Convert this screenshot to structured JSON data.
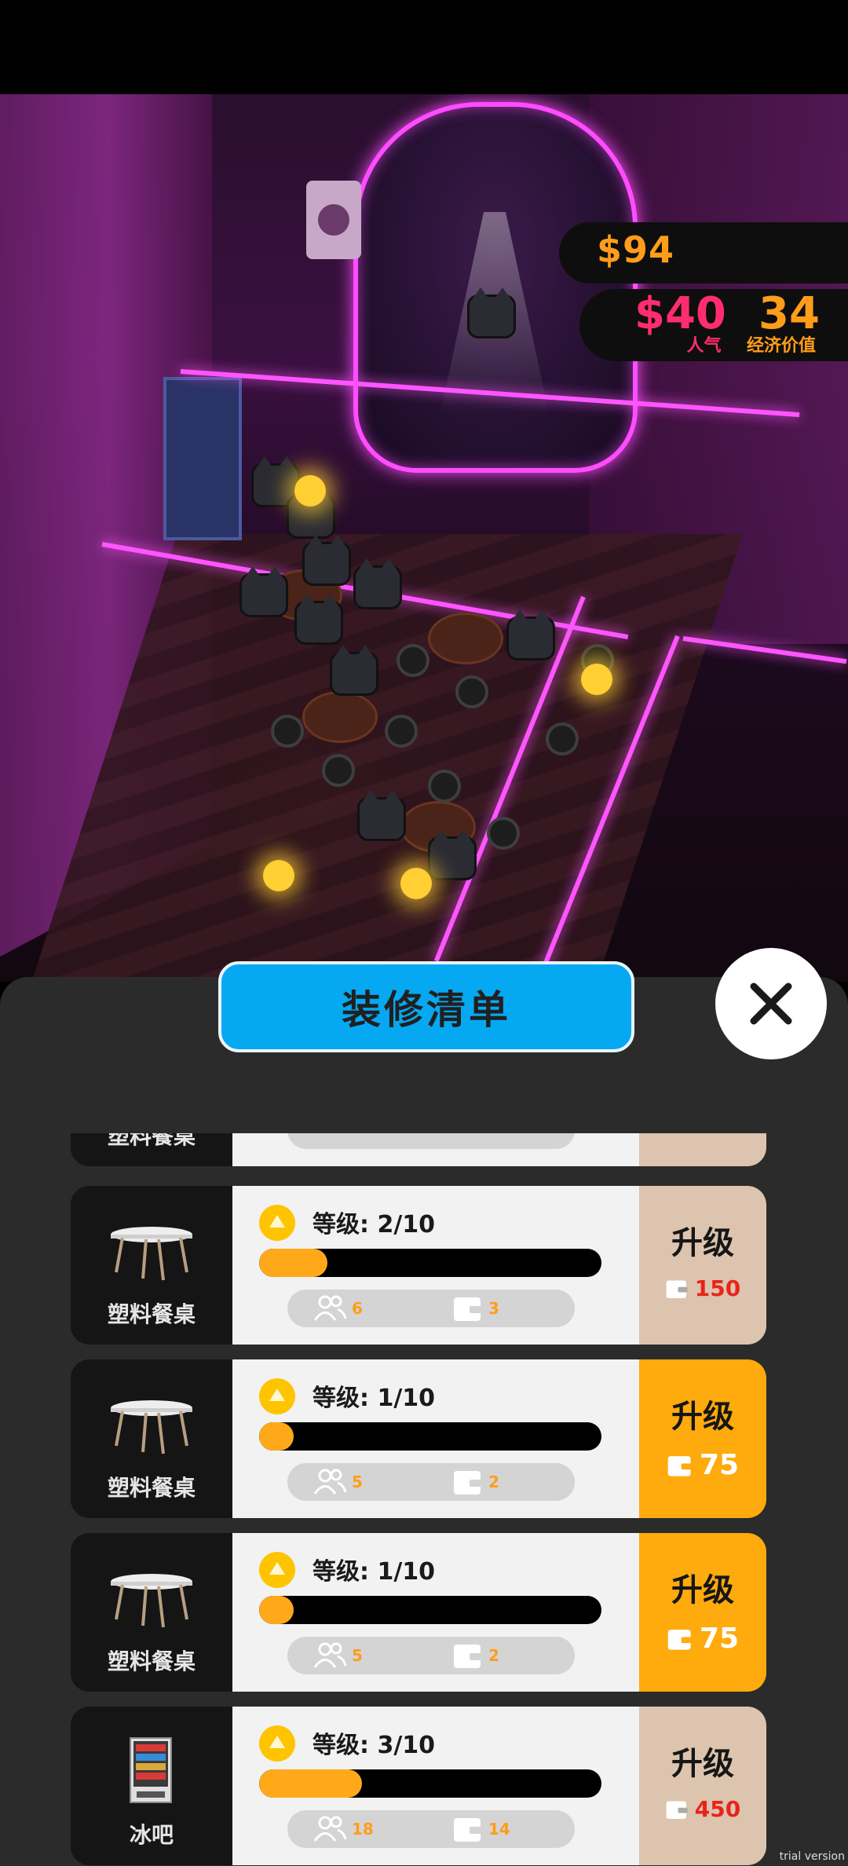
{
  "hud": {
    "money": "$94",
    "popularity_value": "$40",
    "popularity_label": "人气",
    "economic_value": "34",
    "economic_label": "经济价值"
  },
  "panel": {
    "title": "装修清单"
  },
  "upgrade_label": "升级",
  "items": [
    {
      "name": "塑料餐桌",
      "level": "等级: 2/10",
      "progress": 0.2,
      "customers": "6",
      "income": "3",
      "cost": "150",
      "affordable": false,
      "icon": "table-icon"
    },
    {
      "name": "塑料餐桌",
      "level": "等级: 1/10",
      "progress": 0.1,
      "customers": "5",
      "income": "2",
      "cost": "75",
      "affordable": true,
      "icon": "table-icon"
    },
    {
      "name": "塑料餐桌",
      "level": "等级: 1/10",
      "progress": 0.1,
      "customers": "5",
      "income": "2",
      "cost": "75",
      "affordable": true,
      "icon": "table-icon"
    },
    {
      "name": "冰吧",
      "level": "等级: 3/10",
      "progress": 0.3,
      "customers": "18",
      "income": "14",
      "cost": "450",
      "affordable": false,
      "icon": "vending-machine-icon"
    }
  ],
  "partial_item": {
    "name": "塑料餐桌"
  },
  "watermark": "trial version",
  "colors": {
    "title_button": "#06a8f2",
    "upgrade_affordable": "#ffaa0d",
    "upgrade_locked": "#dcc4ae",
    "progress_fill": "#ffa91a",
    "popularity": "#ff2d6f",
    "money": "#ff9d1a"
  }
}
